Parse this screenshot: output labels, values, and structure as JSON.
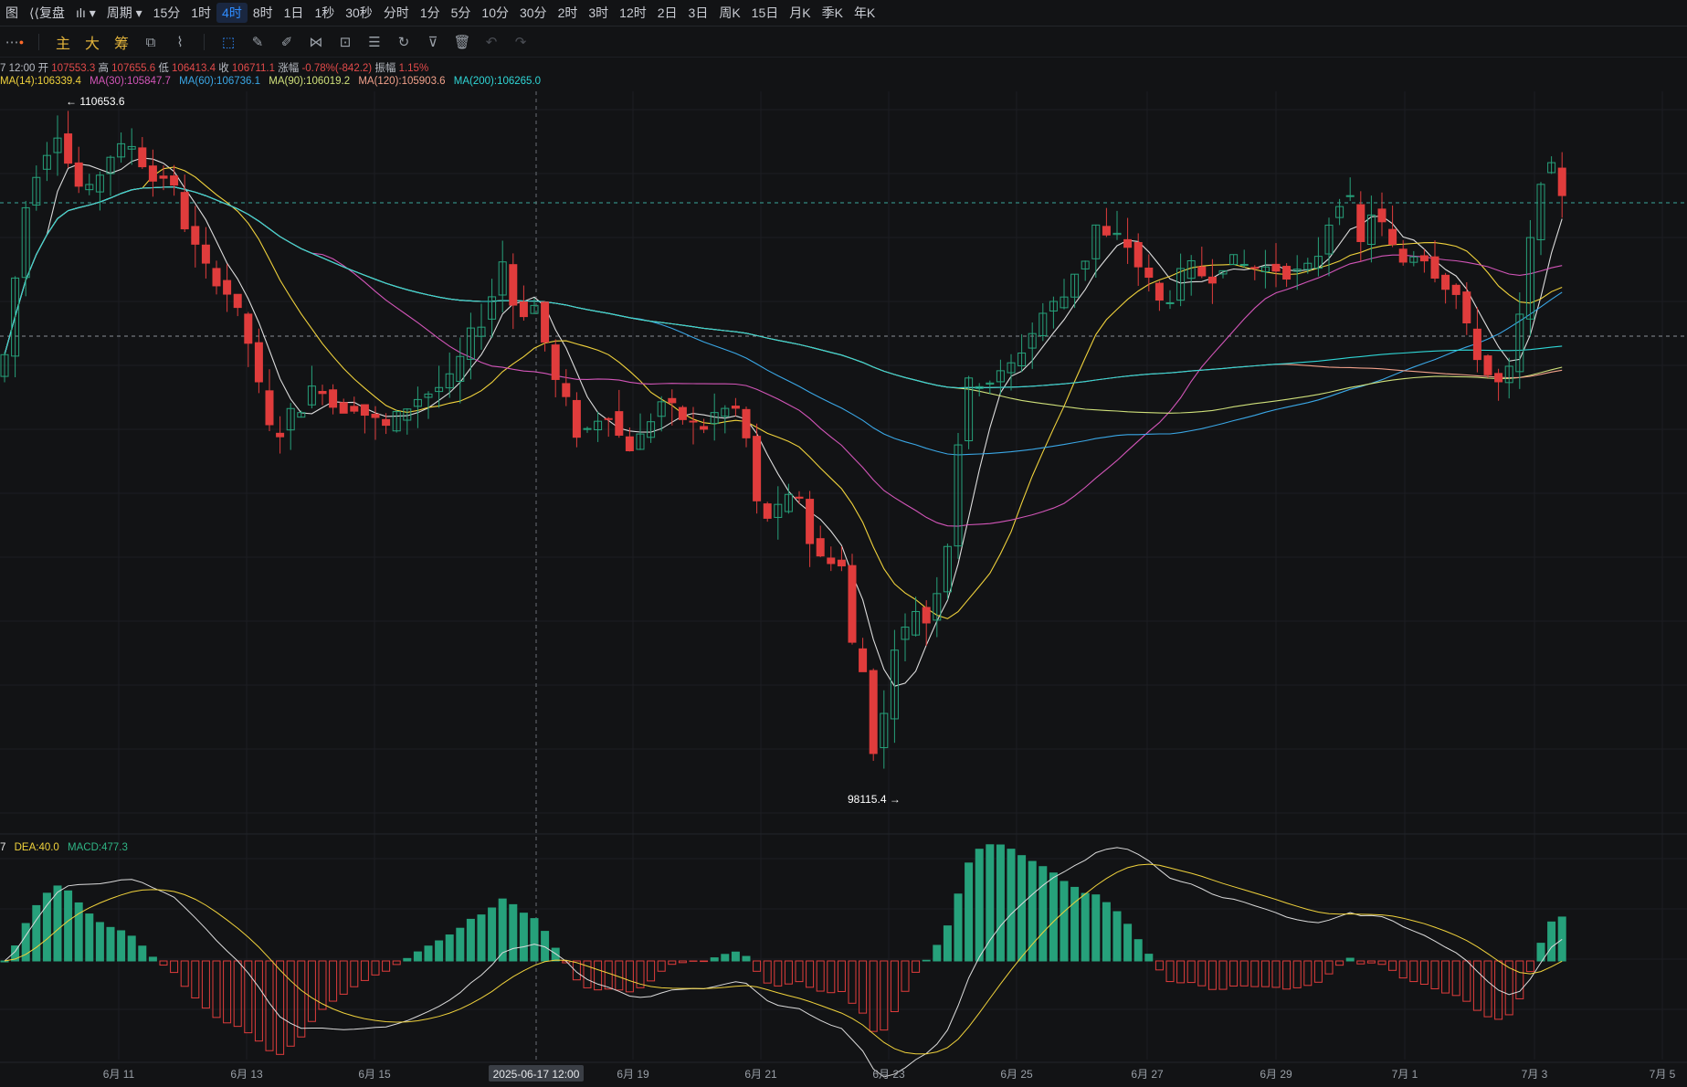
{
  "topbar": {
    "items": [
      {
        "label": "图",
        "active": false
      },
      {
        "label": "复盘",
        "icon": "rewind-icon",
        "active": false
      },
      {
        "label": "",
        "icon": "chart-type-icon",
        "active": false
      },
      {
        "label": "周期",
        "active": false
      },
      {
        "label": "15分",
        "active": false
      },
      {
        "label": "1时",
        "active": false
      },
      {
        "label": "4时",
        "active": true
      },
      {
        "label": "8时",
        "active": false
      },
      {
        "label": "1日",
        "active": false
      },
      {
        "label": "1秒",
        "active": false
      },
      {
        "label": "30秒",
        "active": false
      },
      {
        "label": "分时",
        "active": false
      },
      {
        "label": "1分",
        "active": false
      },
      {
        "label": "5分",
        "active": false
      },
      {
        "label": "10分",
        "active": false
      },
      {
        "label": "30分",
        "active": false
      },
      {
        "label": "2时",
        "active": false
      },
      {
        "label": "3时",
        "active": false
      },
      {
        "label": "12时",
        "active": false
      },
      {
        "label": "2日",
        "active": false
      },
      {
        "label": "3日",
        "active": false
      },
      {
        "label": "周K",
        "active": false
      },
      {
        "label": "15日",
        "active": false
      },
      {
        "label": "月K",
        "active": false
      },
      {
        "label": "季K",
        "active": false
      },
      {
        "label": "年K",
        "active": false
      }
    ]
  },
  "toolbar": {
    "indicator_main": "主",
    "indicator_big": "大",
    "indicator_chip": "筹"
  },
  "info": {
    "time": "7 12:00",
    "open_label": "开",
    "open": "107553.3",
    "high_label": "高",
    "high": "107655.6",
    "low_label": "低",
    "low": "106413.4",
    "close_label": "收",
    "close": "106711.1",
    "change_label": "涨幅",
    "change": "-0.78%(-842.2)",
    "amp_label": "振幅",
    "amp": "1.15%"
  },
  "ma": [
    {
      "label": "MA(14):106339.4",
      "color": "#f0d23c"
    },
    {
      "label": "MA(30):105847.7",
      "color": "#d255b8"
    },
    {
      "label": "MA(60):106736.1",
      "color": "#3aa7e6"
    },
    {
      "label": "MA(90):106019.2",
      "color": "#cfe07a"
    },
    {
      "label": "MA(120):105903.6",
      "color": "#f0a08a"
    },
    {
      "label": "MA(200):106265.0",
      "color": "#2fd6d6"
    }
  ],
  "macd": {
    "dif": "7",
    "dif_color": "#e9e9e9",
    "dea": "DEA:40.0",
    "dea_color": "#f0d23c",
    "macd": "MACD:477.3",
    "macd_color": "#2fb585"
  },
  "annotations": {
    "high": "110653.6",
    "low": "98115.4"
  },
  "crosshair_label": "2025-06-17 12:00",
  "xaxis": [
    "6月 11",
    "6月 13",
    "6月 15",
    "6月 19",
    "6月 21",
    "6月 23",
    "6月 25",
    "6月 27",
    "6月 29",
    "7月 1",
    "7月 3",
    "7月 5"
  ],
  "colors": {
    "up": "#26a17b",
    "down": "#e03c3c",
    "bg": "#121315",
    "grid": "#1c1e22",
    "accent": "#2f8cff"
  },
  "chart_data": {
    "type": "candlestick",
    "interval": "4时",
    "high_marker": 110653.6,
    "low_marker": 98115.4,
    "last": {
      "open": 107553.3,
      "high": 107655.6,
      "low": 106413.4,
      "close": 106711.1
    },
    "ma": {
      "MA14": 106339.4,
      "MA30": 105847.7,
      "MA60": 106736.1,
      "MA90": 106019.2,
      "MA120": 105903.6,
      "MA200": 106265.0
    },
    "macd": {
      "DEA": 40.0,
      "MACD": 477.3
    }
  }
}
